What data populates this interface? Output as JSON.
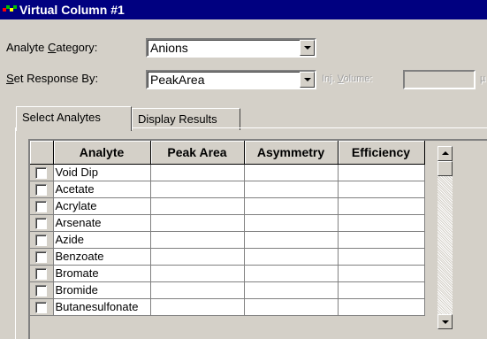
{
  "window": {
    "title": "Virtual Column #1"
  },
  "form": {
    "analyte_category": {
      "label_pre": "Analyte ",
      "label_ul": "C",
      "label_post": "ategory:",
      "value": "Anions"
    },
    "response_by": {
      "label_pre": "",
      "label_ul": "S",
      "label_post": "et Response By:",
      "value": "PeakArea"
    },
    "inj_volume": {
      "label_pre": "Inj. ",
      "label_ul": "V",
      "label_post": "olume:",
      "unit": "µ"
    }
  },
  "tabs": [
    {
      "label": "Select Analytes",
      "active": true
    },
    {
      "label": "Display Results",
      "active": false
    }
  ],
  "grid": {
    "columns": [
      "",
      "Analyte",
      "Peak Area",
      "Asymmetry",
      "Efficiency"
    ],
    "rows": [
      "Void Dip",
      "Acetate",
      "Acrylate",
      "Arsenate",
      "Azide",
      "Benzoate",
      "Bromate",
      "Bromide",
      "Butanesulfonate"
    ]
  },
  "colors": {
    "titlebar": "#000080",
    "face": "#d4d0c8"
  }
}
